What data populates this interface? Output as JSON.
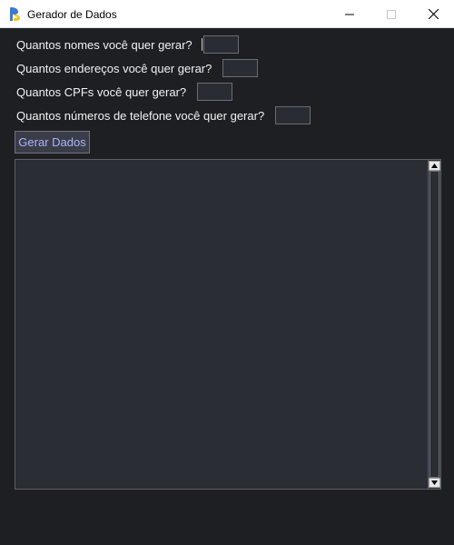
{
  "window": {
    "title": "Gerador de Dados",
    "icon": "python-feather-icon",
    "controls": {
      "minimize": "minimize-icon",
      "maximize": "maximize-icon",
      "close": "close-icon"
    }
  },
  "form": {
    "names_label": "Quantos nomes você quer gerar?",
    "names_value": "",
    "addresses_label": "Quantos endereços você quer gerar?",
    "addresses_value": "",
    "cpfs_label": "Quantos CPFs você quer gerar?",
    "cpfs_value": "",
    "phones_label": "Quantos números de telefone você quer gerar?",
    "phones_value": ""
  },
  "actions": {
    "generate_label": "Gerar Dados"
  },
  "output": {
    "text": ""
  },
  "colors": {
    "background": "#1e1f22",
    "panel": "#2b2d35",
    "button_text": "#a9b4ff",
    "text": "#f2f2f2"
  }
}
